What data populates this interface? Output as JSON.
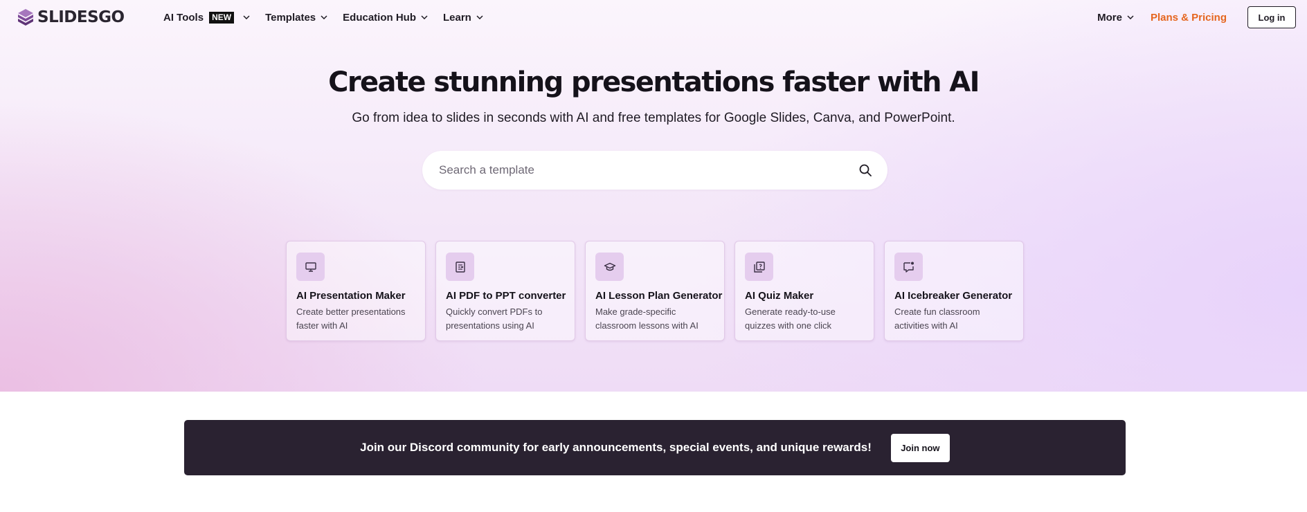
{
  "header": {
    "logo_text": "SLIDESGO",
    "nav": [
      {
        "label": "AI Tools",
        "badge": "NEW"
      },
      {
        "label": "Templates"
      },
      {
        "label": "Education Hub"
      },
      {
        "label": "Learn"
      }
    ],
    "more_label": "More",
    "pricing_label": "Plans & Pricing",
    "login_label": "Log in"
  },
  "hero": {
    "title": "Create stunning presentations faster with AI",
    "subtitle": "Go from idea to slides in seconds with AI and free templates for Google Slides, Canva, and PowerPoint."
  },
  "search": {
    "placeholder": "Search a template",
    "value": ""
  },
  "tools": [
    {
      "icon": "monitor-icon",
      "title": "AI Presentation Maker",
      "desc": "Create better presentations faster with AI"
    },
    {
      "icon": "pdf-convert-icon",
      "title": "AI PDF to PPT converter",
      "desc": "Quickly convert PDFs to presentations using AI"
    },
    {
      "icon": "graduation-cap-icon",
      "title": "AI Lesson Plan Generator",
      "desc": "Make grade-specific classroom lessons with AI"
    },
    {
      "icon": "quiz-icon",
      "title": "AI Quiz Maker",
      "desc": "Generate ready-to-use quizzes with one click"
    },
    {
      "icon": "chat-spark-icon",
      "title": "AI Icebreaker Generator",
      "desc": "Create fun classroom activities with AI"
    }
  ],
  "banner": {
    "text": "Join our Discord community for early announcements, special events, and unique rewards!",
    "button_label": "Join now"
  },
  "colors": {
    "accent_orange": "#e5661f",
    "banner_bg": "#2a2231",
    "logo_purple": "#8e5aa8",
    "card_icon_bg": "#e5cdee"
  }
}
